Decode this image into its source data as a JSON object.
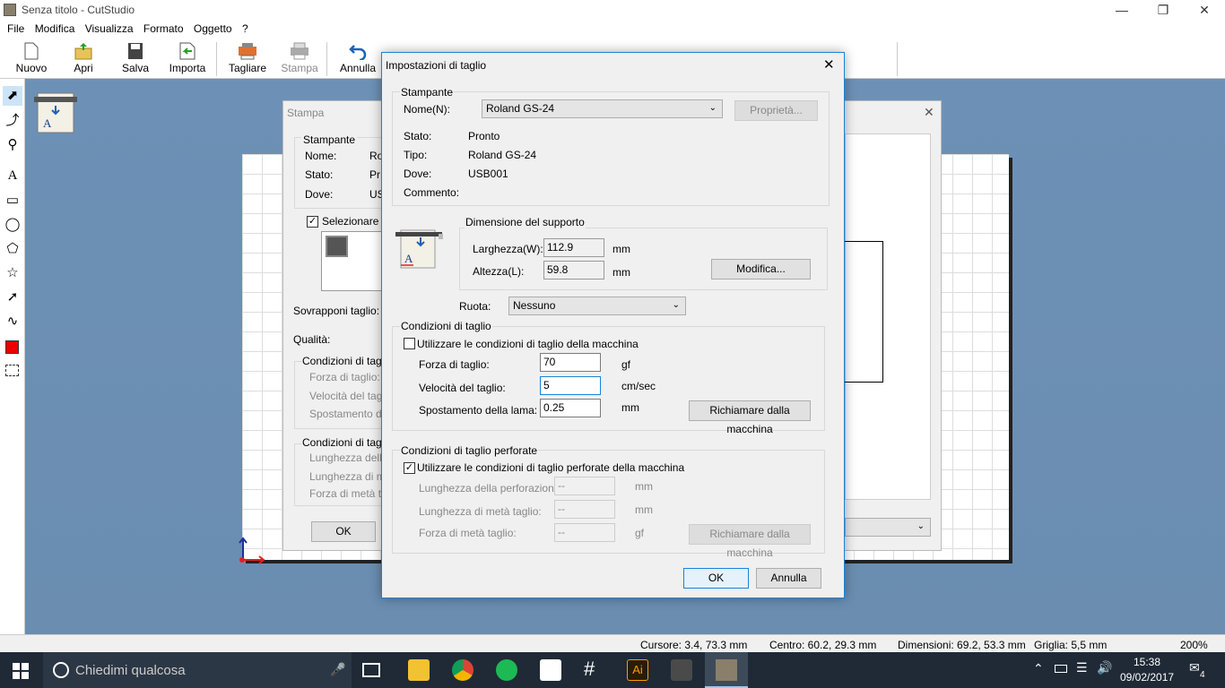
{
  "window": {
    "title": "Senza titolo - CutStudio"
  },
  "menu": [
    "File",
    "Modifica",
    "Visualizza",
    "Formato",
    "Oggetto",
    "?"
  ],
  "toolbar": {
    "nuovo": "Nuovo",
    "apri": "Apri",
    "salva": "Salva",
    "importa": "Importa",
    "tagliare": "Tagliare",
    "stampa": "Stampa",
    "annulla": "Annulla"
  },
  "back_dialog": {
    "title": "Stampa",
    "stampante": "Stampante",
    "nome": "Nome:",
    "nome_val": "Ro",
    "stato": "Stato:",
    "stato_val": "Pr",
    "dove": "Dove:",
    "dove_val": "US",
    "selezionare": "Selezionare il",
    "sovrapponi": "Sovrapponi taglio:",
    "qualita": "Qualità:",
    "condizioni": "Condizioni di taglio",
    "forza": "Forza di taglio:",
    "velocita": "Velocità del taglio",
    "spostamento": "Spostamento della",
    "condizioni2": "Condizioni di taglio",
    "lunghezza": "Lunghezza della",
    "lunghezza_meta": "Lunghezza di metà",
    "forza_meta": "Forza di metà taglio",
    "ok": "OK"
  },
  "dialog": {
    "title": "Impostazioni di taglio",
    "stampante_group": "Stampante",
    "nome_label": "Nome(N):",
    "nome_value": "Roland GS-24",
    "proprieta": "Proprietà...",
    "stato_label": "Stato:",
    "stato_value": "Pronto",
    "tipo_label": "Tipo:",
    "tipo_value": "Roland GS-24",
    "dove_label": "Dove:",
    "dove_value": "USB001",
    "commento_label": "Commento:",
    "dimensione_group": "Dimensione del supporto",
    "larghezza_label": "Larghezza(W):",
    "larghezza_value": "112.9",
    "larghezza_unit": "mm",
    "altezza_label": "Altezza(L):",
    "altezza_value": "59.8",
    "altezza_unit": "mm",
    "modifica": "Modifica...",
    "ruota_label": "Ruota:",
    "ruota_value": "Nessuno",
    "condizioni_group": "Condizioni di taglio",
    "utilizzare_macchina": "Utilizzare le condizioni di taglio della macchina",
    "forza_label": "Forza di taglio:",
    "forza_value": "70",
    "forza_unit": "gf",
    "velocita_label": "Velocità del taglio:",
    "velocita_value": "5",
    "velocita_unit": "cm/sec",
    "spostamento_label": "Spostamento della lama:",
    "spostamento_value": "0.25",
    "spostamento_unit": "mm",
    "richiamare": "Richiamare dalla macchina",
    "perforate_group": "Condizioni di taglio perforate",
    "utilizzare_perforate": "Utilizzare le condizioni di taglio perforate della macchina",
    "lung_perf_label": "Lunghezza della perforazione:",
    "lung_perf_value": "--",
    "lung_perf_unit": "mm",
    "lung_meta_label": "Lunghezza di metà taglio:",
    "lung_meta_value": "--",
    "lung_meta_unit": "mm",
    "forza_meta_label": "Forza di metà taglio:",
    "forza_meta_value": "--",
    "forza_meta_unit": "gf",
    "richiamare2": "Richiamare dalla macchina",
    "ok": "OK",
    "annulla": "Annulla"
  },
  "status": {
    "cursore": "Cursore: 3.4, 73.3 mm",
    "centro": "Centro: 60.2, 29.3 mm",
    "dimensioni": "Dimensioni: 69.2, 53.3 mm",
    "griglia": "Griglia: 5,5 mm",
    "zoom": "200%"
  },
  "taskbar": {
    "search": "Chiedimi qualcosa",
    "time": "15:38",
    "date": "09/02/2017",
    "notifications": "4",
    "ai": "Ai"
  },
  "colors": {
    "accent": "#1883d7",
    "workspace": "#6b8fb3"
  }
}
